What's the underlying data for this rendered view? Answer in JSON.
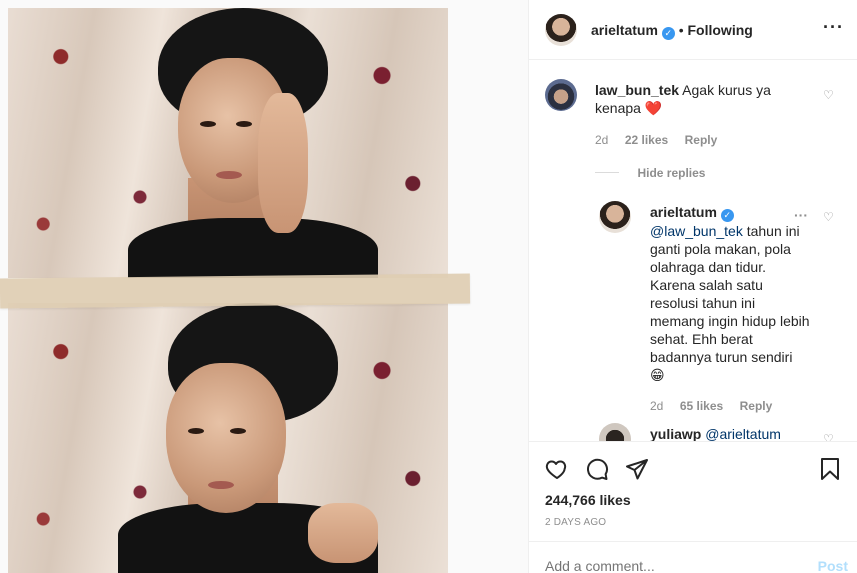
{
  "header": {
    "username": "arieltatum",
    "follow_status": "Following",
    "more_icon": "more-horizontal-icon"
  },
  "comments": [
    {
      "username": "law_bun_tek",
      "text": "Agak kurus ya kenapa",
      "emoji": "❤️",
      "age": "2d",
      "likes": "22 likes",
      "reply_label": "Reply"
    }
  ],
  "hide_replies": "Hide replies",
  "reply": {
    "username": "arieltatum",
    "mention": "@law_bun_tek",
    "text": "tahun ini ganti pola makan, pola olahraga dan tidur. Karena salah satu resolusi tahun ini memang ingin hidup lebih sehat. Ehh berat badannya turun sendiri",
    "emoji": "😁",
    "age": "2d",
    "likes": "65 likes",
    "reply_label": "Reply"
  },
  "next_comment": {
    "username": "yuliawp",
    "mention": "@arieltatum"
  },
  "post": {
    "likes": "244,766 likes",
    "date": "2 DAYS AGO",
    "comment_placeholder": "Add a comment...",
    "post_label": "Post"
  },
  "colors": {
    "verified": "#3897f0",
    "link": "#003569",
    "heart_red": "#ed4956",
    "muted": "#8e8e8e",
    "post_disabled": "#b2dffc"
  },
  "icons": [
    "heart-icon",
    "comment-icon",
    "share-icon",
    "bookmark-icon",
    "verified-badge-icon"
  ]
}
